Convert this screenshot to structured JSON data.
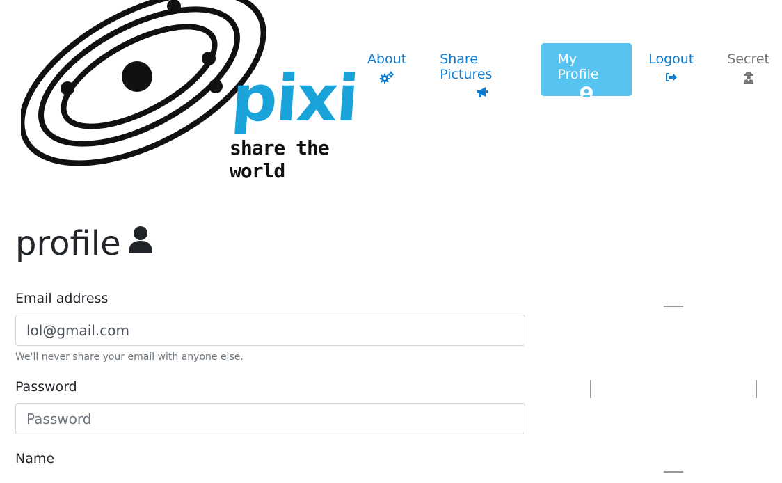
{
  "logo": {
    "word": "pixi",
    "tagline": "share the world"
  },
  "nav": [
    {
      "label": "About",
      "icon": "gears-icon"
    },
    {
      "label": "Share Pictures",
      "icon": "bullhorn-icon"
    },
    {
      "label": "My Profile",
      "icon": "user-circle-icon"
    },
    {
      "label": "Logout",
      "icon": "sign-out-icon"
    },
    {
      "label": "Secret",
      "icon": "user-secret-icon"
    }
  ],
  "page": {
    "title": "profile"
  },
  "form": {
    "email_label": "Email address",
    "email_value": "lol@gmail.com",
    "email_help": "We'll never share your email with anyone else.",
    "password_label": "Password",
    "password_placeholder": "Password",
    "name_label": "Name"
  },
  "colors": {
    "accent": "#56c3f0",
    "link": "#0d7bd0",
    "logo": "#1aa3d9"
  }
}
